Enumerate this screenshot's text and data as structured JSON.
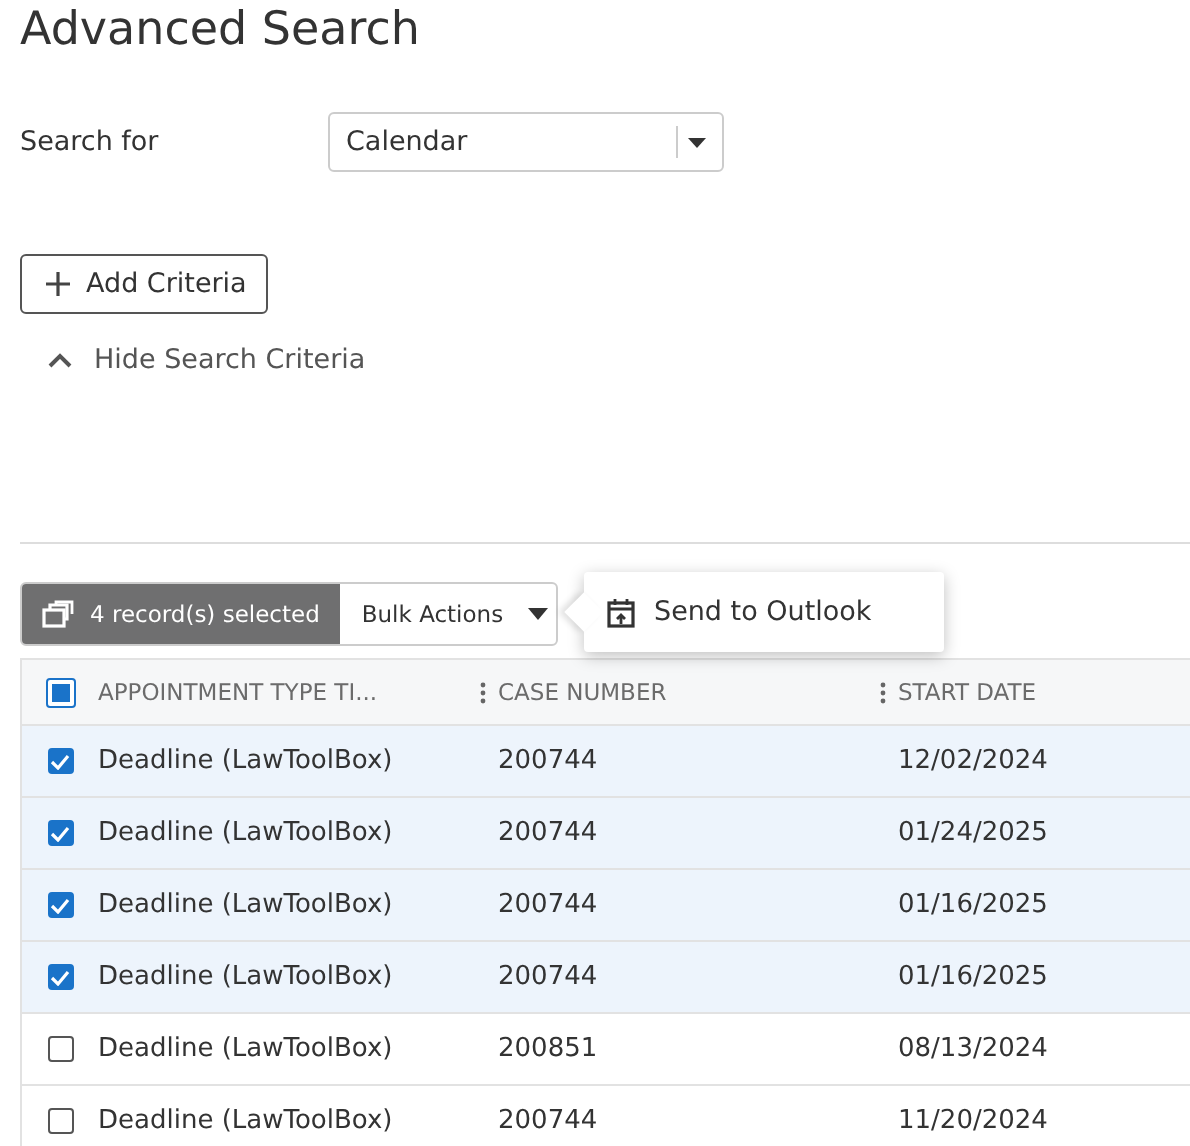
{
  "title": "Advanced Search",
  "search_for": {
    "label": "Search for",
    "value": "Calendar"
  },
  "add_criteria": "Add Criteria",
  "hide_criteria": "Hide Search Criteria",
  "selection": {
    "count_label": "4 record(s) selected",
    "bulk_actions": "Bulk Actions"
  },
  "popup_menu": {
    "items": [
      "Send to Outlook"
    ]
  },
  "table": {
    "select_all": {
      "indeterminate": true
    },
    "columns": [
      "APPOINTMENT TYPE TI...",
      "CASE NUMBER",
      "START DATE"
    ],
    "rows": [
      {
        "selected": true,
        "cells": [
          "Deadline (LawToolBox)",
          "200744",
          "12/02/2024"
        ]
      },
      {
        "selected": true,
        "cells": [
          "Deadline (LawToolBox)",
          "200744",
          "01/24/2025"
        ]
      },
      {
        "selected": true,
        "cells": [
          "Deadline (LawToolBox)",
          "200744",
          "01/16/2025"
        ]
      },
      {
        "selected": true,
        "cells": [
          "Deadline (LawToolBox)",
          "200744",
          "01/16/2025"
        ]
      },
      {
        "selected": false,
        "cells": [
          "Deadline (LawToolBox)",
          "200851",
          "08/13/2024"
        ]
      },
      {
        "selected": false,
        "cells": [
          "Deadline (LawToolBox)",
          "200744",
          "11/20/2024"
        ]
      }
    ]
  }
}
